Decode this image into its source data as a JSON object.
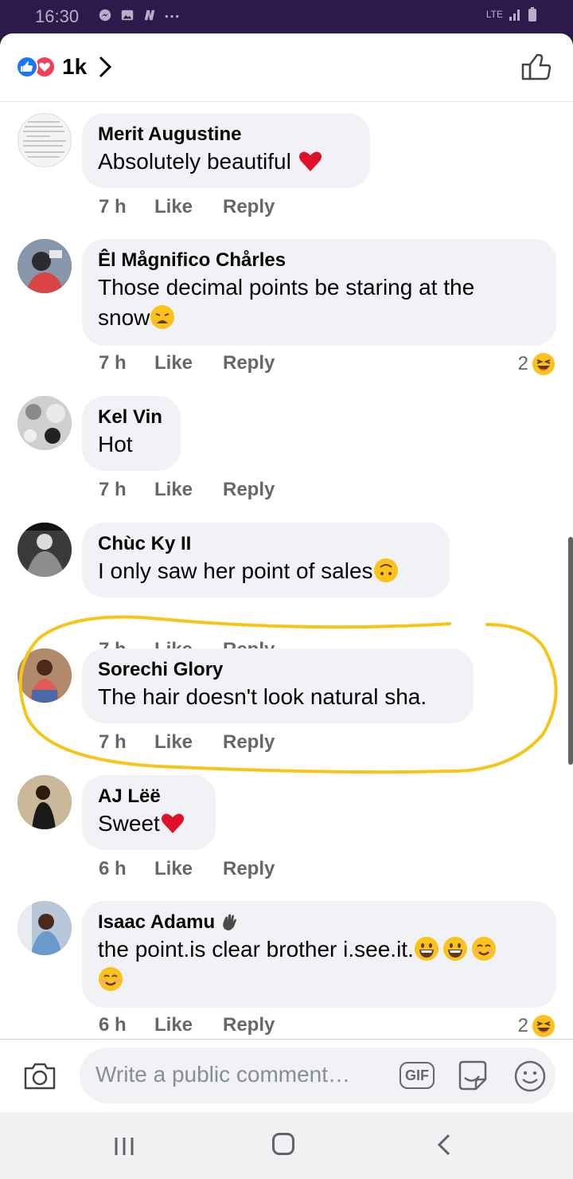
{
  "status_bar": {
    "time": "16:30",
    "network": "LTE"
  },
  "header": {
    "reaction_count": "1k"
  },
  "comments": [
    {
      "name": "Merit Augustine",
      "text": "Absolutely beautiful",
      "time": "7 h",
      "like": "Like",
      "reply": "Reply"
    },
    {
      "name": "Êl Mågnifico Chårles",
      "text_line1": "Those decimal points be staring at the",
      "text_line2": "snow",
      "time": "7 h",
      "like": "Like",
      "reply": "Reply",
      "reaction_count": "2"
    },
    {
      "name": "Kel Vin",
      "text": "Hot",
      "time": "7 h",
      "like": "Like",
      "reply": "Reply"
    },
    {
      "name": "Chùc Ky II",
      "text": "I only saw her point of sales",
      "time": "7 h",
      "like": "Like",
      "reply": "Reply"
    },
    {
      "name": "Sorechi Glory",
      "text": "The hair doesn't look natural sha.",
      "time": "7 h",
      "like": "Like",
      "reply": "Reply"
    },
    {
      "name": "AJ Lëë",
      "text": "Sweet",
      "time": "6 h",
      "like": "Like",
      "reply": "Reply"
    },
    {
      "name": "Isaac Adamu",
      "text": "the point.is clear brother i.see.it.",
      "time": "6 h",
      "like": "Like",
      "reply": "Reply",
      "reaction_count": "2"
    }
  ],
  "composer": {
    "placeholder": "Write a public comment…",
    "gif_label": "GIF"
  },
  "colors": {
    "accent": "#1877f2",
    "love": "#f33e58",
    "highlight": "#f5c518",
    "bubble": "#f0f2f5",
    "status_bar": "#2e1a4a"
  },
  "icons": [
    "like-reaction-icon",
    "love-reaction-icon",
    "chevron-right-icon",
    "thumbs-up-icon",
    "camera-icon",
    "gif-icon",
    "sticker-icon",
    "emoji-icon",
    "recent-apps-icon",
    "home-icon",
    "back-icon"
  ]
}
